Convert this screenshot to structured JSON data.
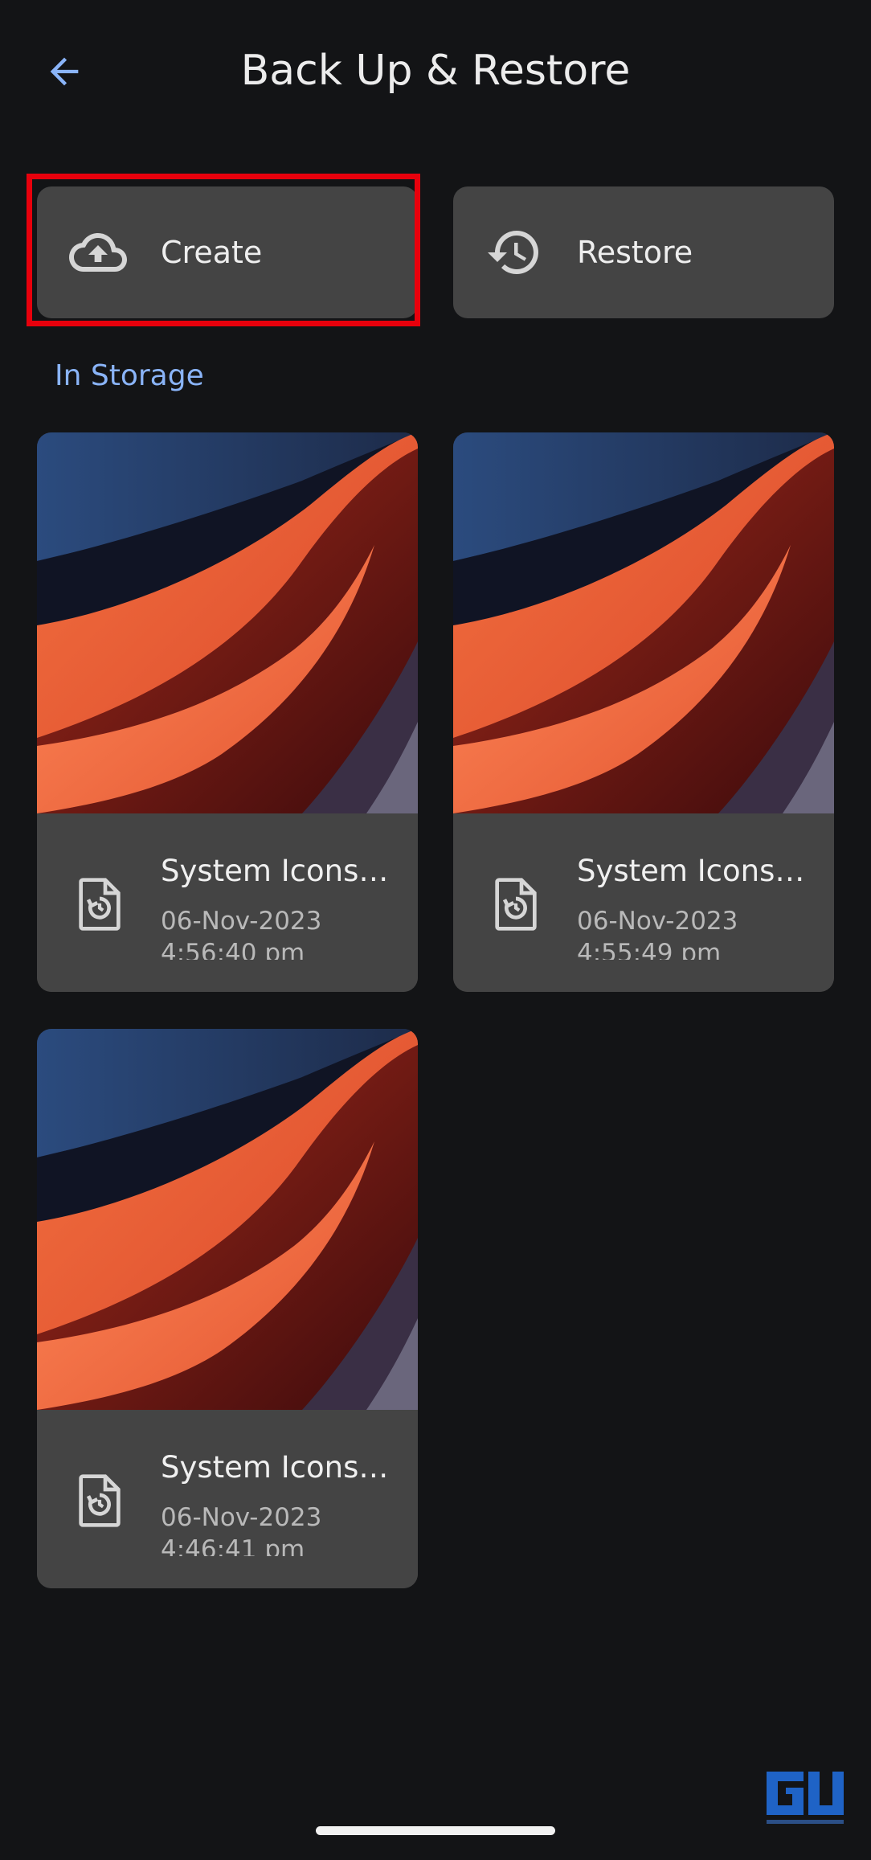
{
  "header": {
    "title": "Back Up & Restore",
    "back_icon": "arrow-back-icon"
  },
  "actions": {
    "create_label": "Create",
    "create_icon": "cloud-upload-icon",
    "restore_label": "Restore",
    "restore_icon": "history-icon",
    "highlight_color": "#e8000c"
  },
  "storage": {
    "section_label": "In Storage",
    "backups": [
      {
        "name": "System Icons,...",
        "date": "06-Nov-2023",
        "time": "4:56:40 pm"
      },
      {
        "name": "System Icons,...",
        "date": "06-Nov-2023",
        "time": "4:55:49 pm"
      },
      {
        "name": "System Icons,...",
        "date": "06-Nov-2023",
        "time": "4:46:41 pm"
      }
    ]
  },
  "colors": {
    "background": "#131416",
    "card": "#444444",
    "accent": "#8ab4f8"
  }
}
